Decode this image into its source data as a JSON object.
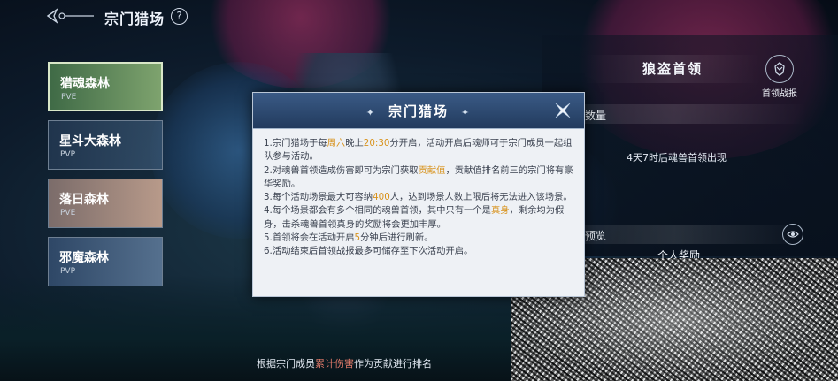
{
  "header": {
    "title": "宗门猎场",
    "help_label": "?"
  },
  "maps": [
    {
      "name": "猎魂森林",
      "tag": "PVE"
    },
    {
      "name": "星斗大森林",
      "tag": "PVP"
    },
    {
      "name": "落日森林",
      "tag": "PVE"
    },
    {
      "name": "邪魔森林",
      "tag": "PVP"
    }
  ],
  "boss_panel": {
    "title": "狼盗首领",
    "report_label": "首领战报",
    "quantity_label": "数量",
    "spawn_text": "4天7时后魂兽首领出现",
    "preview_label": "预览",
    "reward_label": "个人奖励"
  },
  "rank_caption": {
    "prefix": "根据宗门成员",
    "highlight": "累计伤害",
    "suffix": "作为贡献进行排名"
  },
  "modal": {
    "title": "宗门猎场",
    "star_left": "✦",
    "star_right": "✦",
    "rules": [
      {
        "parts": [
          [
            "1.宗门猎场于每",
            ""
          ],
          [
            "周六",
            "y"
          ],
          [
            "晚上",
            ""
          ],
          [
            "20:30",
            "y"
          ],
          [
            "分开启，活动开启后魂师可于宗门成员一起组队参与活动。",
            ""
          ]
        ]
      },
      {
        "parts": [
          [
            "2.对魂兽首领造成伤害即可为宗门获取",
            ""
          ],
          [
            "贡献值",
            "y"
          ],
          [
            "，贡献值排名前三的宗门将有豪华奖励。",
            ""
          ]
        ]
      },
      {
        "parts": [
          [
            "3.每个活动场景最大可容纳",
            ""
          ],
          [
            "400",
            "y"
          ],
          [
            "人，达到场景人数上限后将无法进入该场景。",
            ""
          ]
        ]
      },
      {
        "parts": [
          [
            "4.每个场景都会有多个相同的魂兽首领，其中只有一个是",
            ""
          ],
          [
            "真身",
            "y"
          ],
          [
            "，剩余均为假身，击杀魂兽首领真身的奖励将会更加丰厚。",
            ""
          ]
        ]
      },
      {
        "parts": [
          [
            "5.首领将会在活动开启",
            ""
          ],
          [
            "5",
            "y"
          ],
          [
            "分钟后进行刷新。",
            ""
          ]
        ]
      },
      {
        "parts": [
          [
            "6.活动结束后首领战报最多可储存至下次活动开启。",
            ""
          ]
        ]
      }
    ]
  }
}
